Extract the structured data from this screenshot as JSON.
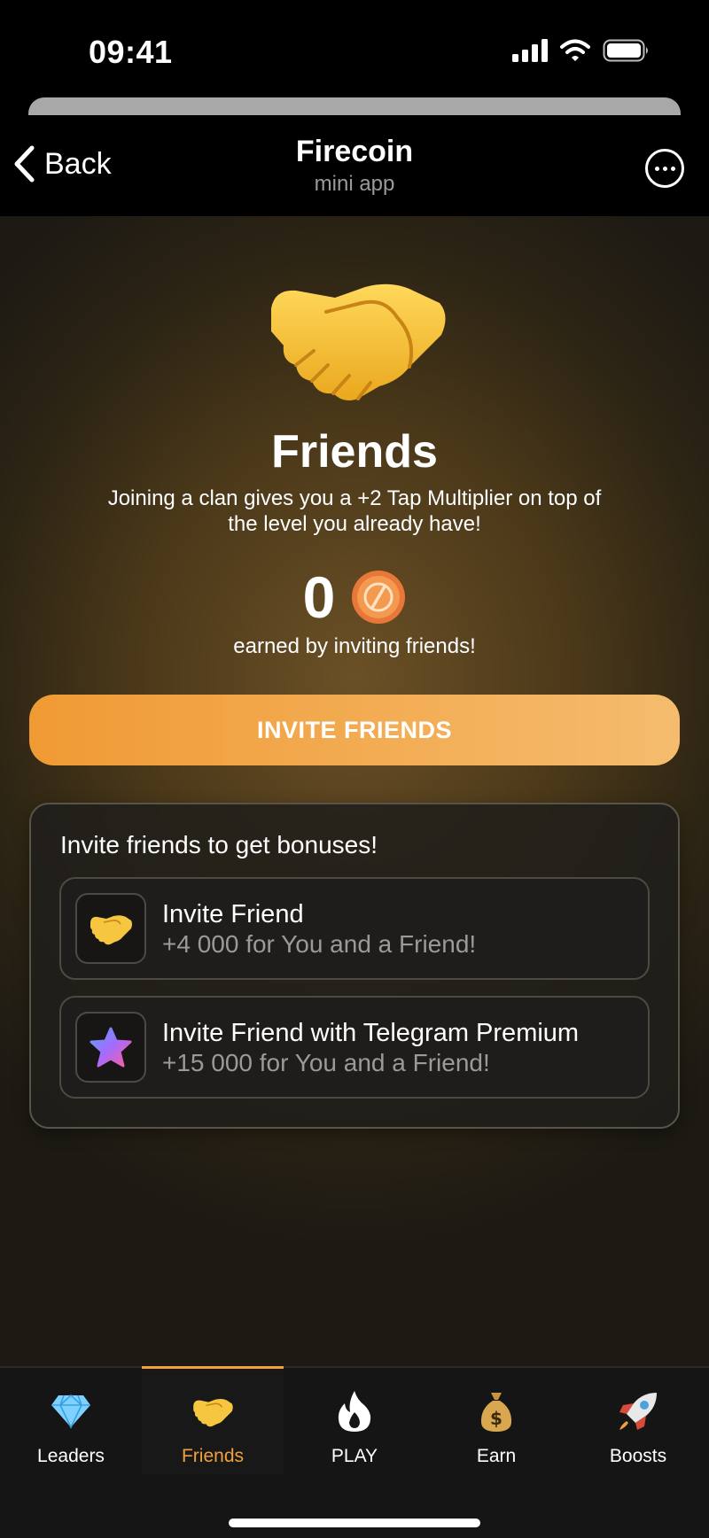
{
  "status": {
    "time": "09:41"
  },
  "nav": {
    "back_label": "Back",
    "title": "Firecoin",
    "subtitle": "mini app"
  },
  "hero": {
    "title": "Friends",
    "description": "Joining a clan gives you a +2 Tap Multiplier on top of the level you already have!",
    "earned_value": "0",
    "earned_caption": "earned by inviting friends!"
  },
  "invite_button": {
    "label": "INVITE FRIENDS"
  },
  "bonuses": {
    "heading": "Invite friends to get bonuses!",
    "items": [
      {
        "icon": "handshake-icon",
        "title": "Invite Friend",
        "subtitle": "+4 000 for You and a Friend!"
      },
      {
        "icon": "star-icon",
        "title": "Invite Friend with Telegram Premium",
        "subtitle": "+15 000 for You and a Friend!"
      }
    ]
  },
  "tabs": [
    {
      "label": "Leaders",
      "icon": "diamond-icon",
      "active": false
    },
    {
      "label": "Friends",
      "icon": "handshake-icon",
      "active": true
    },
    {
      "label": "PLAY",
      "icon": "flame-icon",
      "active": false
    },
    {
      "label": "Earn",
      "icon": "money-bag-icon",
      "active": false
    },
    {
      "label": "Boosts",
      "icon": "rocket-icon",
      "active": false
    }
  ],
  "colors": {
    "accent": "#F0A03C",
    "button_start": "#F09A34",
    "button_end": "#F5BC6E",
    "background": "#000000"
  }
}
